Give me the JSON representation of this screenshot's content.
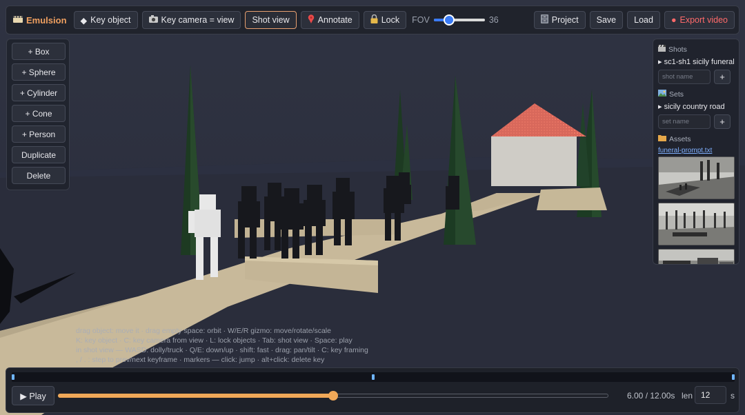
{
  "app": {
    "name": "Emulsion"
  },
  "toolbar": {
    "key_object": "Key object",
    "key_camera": "Key camera = view",
    "shot_view": "Shot view",
    "annotate": "Annotate",
    "lock": "Lock",
    "fov_label": "FOV",
    "fov_value": "36",
    "fov_fraction": 0.25,
    "project": "Project",
    "save": "Save",
    "load": "Load",
    "export": "Export video"
  },
  "tools": {
    "box": "+ Box",
    "sphere": "+ Sphere",
    "cylinder": "+ Cylinder",
    "cone": "+ Cone",
    "person": "+ Person",
    "duplicate": "Duplicate",
    "delete": "Delete"
  },
  "panel": {
    "shots_title": "Shots",
    "shot_item": "▸ sc1-sh1 sicily funeral",
    "shot_placeholder": "shot name",
    "add_label": "+",
    "sets_title": "Sets",
    "set_item": "▸ sicily country road",
    "set_placeholder": "set name",
    "assets_title": "Assets",
    "asset_file": "funeral-prompt.txt"
  },
  "help": {
    "line1": "drag object: move it · drag empty space: orbit · W/E/R gizmo: move/rotate/scale",
    "line2": "K: key object · C: key camera from view · L: lock objects · Tab: shot view · Space: play",
    "line3": "in shot view — WASD: dolly/truck · Q/E: down/up · shift: fast · drag: pan/tilt · C: key framing",
    "line4": ", / . : step to prev/next keyframe · markers — click: jump · alt+click: delete key"
  },
  "timeline": {
    "play_label": "▶ Play",
    "time_readout": "6.00 / 12.00s",
    "current_seconds": 6,
    "total_seconds": 12,
    "len_label": "len",
    "len_value": "12",
    "unit": "s",
    "keyframes_seconds": [
      0,
      6,
      12
    ]
  },
  "colors": {
    "accent": "#f0a858",
    "brand": "#f0a060",
    "export": "#ff6a6a",
    "link": "#7fb0ff"
  }
}
